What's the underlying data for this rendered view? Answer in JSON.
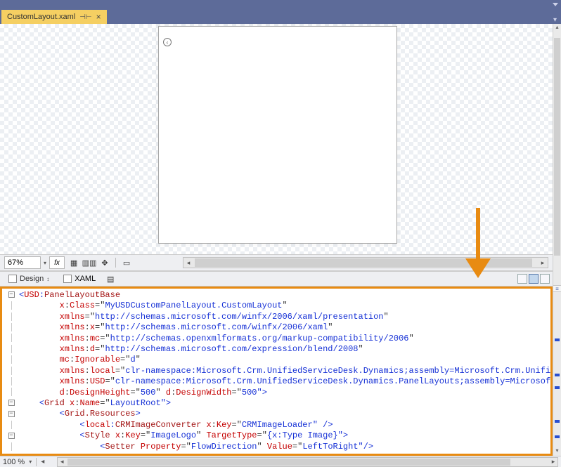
{
  "tab": {
    "filename": "CustomLayout.xaml"
  },
  "designer": {
    "zoom": "67%",
    "fx": "fx"
  },
  "views": {
    "design": "Design",
    "xaml": "XAML"
  },
  "status": {
    "zoom": "100 %"
  },
  "code": {
    "lines": [
      {
        "gutter": "−",
        "indent": 0,
        "parts": [
          {
            "t": "<",
            "c": "c-pun"
          },
          {
            "t": "USD",
            "c": "c-attr"
          },
          {
            "t": ":",
            "c": "c-pun"
          },
          {
            "t": "PanelLayoutBase",
            "c": "c-tag"
          }
        ]
      },
      {
        "indent": 8,
        "parts": [
          {
            "t": "x",
            "c": "c-attr"
          },
          {
            "t": ":",
            "c": "c-eq"
          },
          {
            "t": "Class",
            "c": "c-attr"
          },
          {
            "t": "=\"",
            "c": "c-eq"
          },
          {
            "t": "MyUSDCustomPanelLayout.CustomLayout",
            "c": "c-val"
          },
          {
            "t": "\"",
            "c": "c-eq"
          }
        ]
      },
      {
        "indent": 8,
        "parts": [
          {
            "t": "xmlns",
            "c": "c-attr"
          },
          {
            "t": "=\"",
            "c": "c-eq"
          },
          {
            "t": "http://schemas.microsoft.com/winfx/2006/xaml/presentation",
            "c": "c-val"
          },
          {
            "t": "\"",
            "c": "c-eq"
          }
        ]
      },
      {
        "indent": 8,
        "parts": [
          {
            "t": "xmlns",
            "c": "c-attr"
          },
          {
            "t": ":",
            "c": "c-eq"
          },
          {
            "t": "x",
            "c": "c-attr"
          },
          {
            "t": "=\"",
            "c": "c-eq"
          },
          {
            "t": "http://schemas.microsoft.com/winfx/2006/xaml",
            "c": "c-val"
          },
          {
            "t": "\"",
            "c": "c-eq"
          }
        ]
      },
      {
        "indent": 8,
        "parts": [
          {
            "t": "xmlns",
            "c": "c-attr"
          },
          {
            "t": ":",
            "c": "c-eq"
          },
          {
            "t": "mc",
            "c": "c-attr"
          },
          {
            "t": "=\"",
            "c": "c-eq"
          },
          {
            "t": "http://schemas.openxmlformats.org/markup-compatibility/2006",
            "c": "c-val"
          },
          {
            "t": "\"",
            "c": "c-eq"
          }
        ]
      },
      {
        "indent": 8,
        "parts": [
          {
            "t": "xmlns",
            "c": "c-attr"
          },
          {
            "t": ":",
            "c": "c-eq"
          },
          {
            "t": "d",
            "c": "c-attr"
          },
          {
            "t": "=\"",
            "c": "c-eq"
          },
          {
            "t": "http://schemas.microsoft.com/expression/blend/2008",
            "c": "c-val"
          },
          {
            "t": "\"",
            "c": "c-eq"
          }
        ]
      },
      {
        "indent": 8,
        "parts": [
          {
            "t": "mc",
            "c": "c-attr"
          },
          {
            "t": ":",
            "c": "c-eq"
          },
          {
            "t": "Ignorable",
            "c": "c-attr"
          },
          {
            "t": "=\"",
            "c": "c-eq"
          },
          {
            "t": "d",
            "c": "c-val"
          },
          {
            "t": "\"",
            "c": "c-eq"
          }
        ]
      },
      {
        "indent": 8,
        "parts": [
          {
            "t": "xmlns",
            "c": "c-attr"
          },
          {
            "t": ":",
            "c": "c-eq"
          },
          {
            "t": "local",
            "c": "c-attr"
          },
          {
            "t": "=\"",
            "c": "c-eq"
          },
          {
            "t": "clr-namespace:Microsoft.Crm.UnifiedServiceDesk.Dynamics;assembly=Microsoft.Crm.Unifi",
            "c": "c-val"
          }
        ]
      },
      {
        "indent": 8,
        "parts": [
          {
            "t": "xmlns",
            "c": "c-attr"
          },
          {
            "t": ":",
            "c": "c-eq"
          },
          {
            "t": "USD",
            "c": "c-attr"
          },
          {
            "t": "=\"",
            "c": "c-eq"
          },
          {
            "t": "clr-namespace:Microsoft.Crm.UnifiedServiceDesk.Dynamics.PanelLayouts;assembly=Microsof",
            "c": "c-val"
          }
        ]
      },
      {
        "indent": 8,
        "parts": [
          {
            "t": "d",
            "c": "c-attr"
          },
          {
            "t": ":",
            "c": "c-eq"
          },
          {
            "t": "DesignHeight",
            "c": "c-attr"
          },
          {
            "t": "=\"",
            "c": "c-eq"
          },
          {
            "t": "500",
            "c": "c-val"
          },
          {
            "t": "\" ",
            "c": "c-eq"
          },
          {
            "t": "d",
            "c": "c-attr"
          },
          {
            "t": ":",
            "c": "c-eq"
          },
          {
            "t": "DesignWidth",
            "c": "c-attr"
          },
          {
            "t": "=\"",
            "c": "c-eq"
          },
          {
            "t": "500",
            "c": "c-val"
          },
          {
            "t": "\">",
            "c": "c-pun"
          }
        ]
      },
      {
        "gutter": "−",
        "indent": 4,
        "parts": [
          {
            "t": "<",
            "c": "c-pun"
          },
          {
            "t": "Grid ",
            "c": "c-tag"
          },
          {
            "t": "x",
            "c": "c-attr"
          },
          {
            "t": ":",
            "c": "c-eq"
          },
          {
            "t": "Name",
            "c": "c-attr"
          },
          {
            "t": "=\"",
            "c": "c-eq"
          },
          {
            "t": "LayoutRoot",
            "c": "c-val"
          },
          {
            "t": "\">",
            "c": "c-pun"
          }
        ]
      },
      {
        "gutter": "−",
        "indent": 8,
        "parts": [
          {
            "t": "<",
            "c": "c-pun"
          },
          {
            "t": "Grid.Resources",
            "c": "c-tag"
          },
          {
            "t": ">",
            "c": "c-pun"
          }
        ]
      },
      {
        "indent": 12,
        "parts": [
          {
            "t": "<",
            "c": "c-pun"
          },
          {
            "t": "local",
            "c": "c-attr"
          },
          {
            "t": ":",
            "c": "c-pun"
          },
          {
            "t": "CRMImageConverter ",
            "c": "c-tag"
          },
          {
            "t": "x",
            "c": "c-attr"
          },
          {
            "t": ":",
            "c": "c-eq"
          },
          {
            "t": "Key",
            "c": "c-attr"
          },
          {
            "t": "=\"",
            "c": "c-eq"
          },
          {
            "t": "CRMImageLoader",
            "c": "c-val"
          },
          {
            "t": "\" />",
            "c": "c-pun"
          }
        ]
      },
      {
        "gutter": "−",
        "indent": 12,
        "parts": [
          {
            "t": "<",
            "c": "c-pun"
          },
          {
            "t": "Style ",
            "c": "c-tag"
          },
          {
            "t": "x",
            "c": "c-attr"
          },
          {
            "t": ":",
            "c": "c-eq"
          },
          {
            "t": "Key",
            "c": "c-attr"
          },
          {
            "t": "=\"",
            "c": "c-eq"
          },
          {
            "t": "ImageLogo",
            "c": "c-val"
          },
          {
            "t": "\" ",
            "c": "c-eq"
          },
          {
            "t": "TargetType",
            "c": "c-attr"
          },
          {
            "t": "=\"",
            "c": "c-eq"
          },
          {
            "t": "{x:Type Image}",
            "c": "c-val"
          },
          {
            "t": "\">",
            "c": "c-pun"
          }
        ]
      },
      {
        "indent": 16,
        "parts": [
          {
            "t": "<",
            "c": "c-pun"
          },
          {
            "t": "Setter ",
            "c": "c-tag"
          },
          {
            "t": "Property",
            "c": "c-attr"
          },
          {
            "t": "=\"",
            "c": "c-eq"
          },
          {
            "t": "FlowDirection",
            "c": "c-val"
          },
          {
            "t": "\" ",
            "c": "c-eq"
          },
          {
            "t": "Value",
            "c": "c-attr"
          },
          {
            "t": "=\"",
            "c": "c-eq"
          },
          {
            "t": "LeftToRight",
            "c": "c-val"
          },
          {
            "t": "\"/>",
            "c": "c-pun"
          }
        ]
      }
    ]
  }
}
